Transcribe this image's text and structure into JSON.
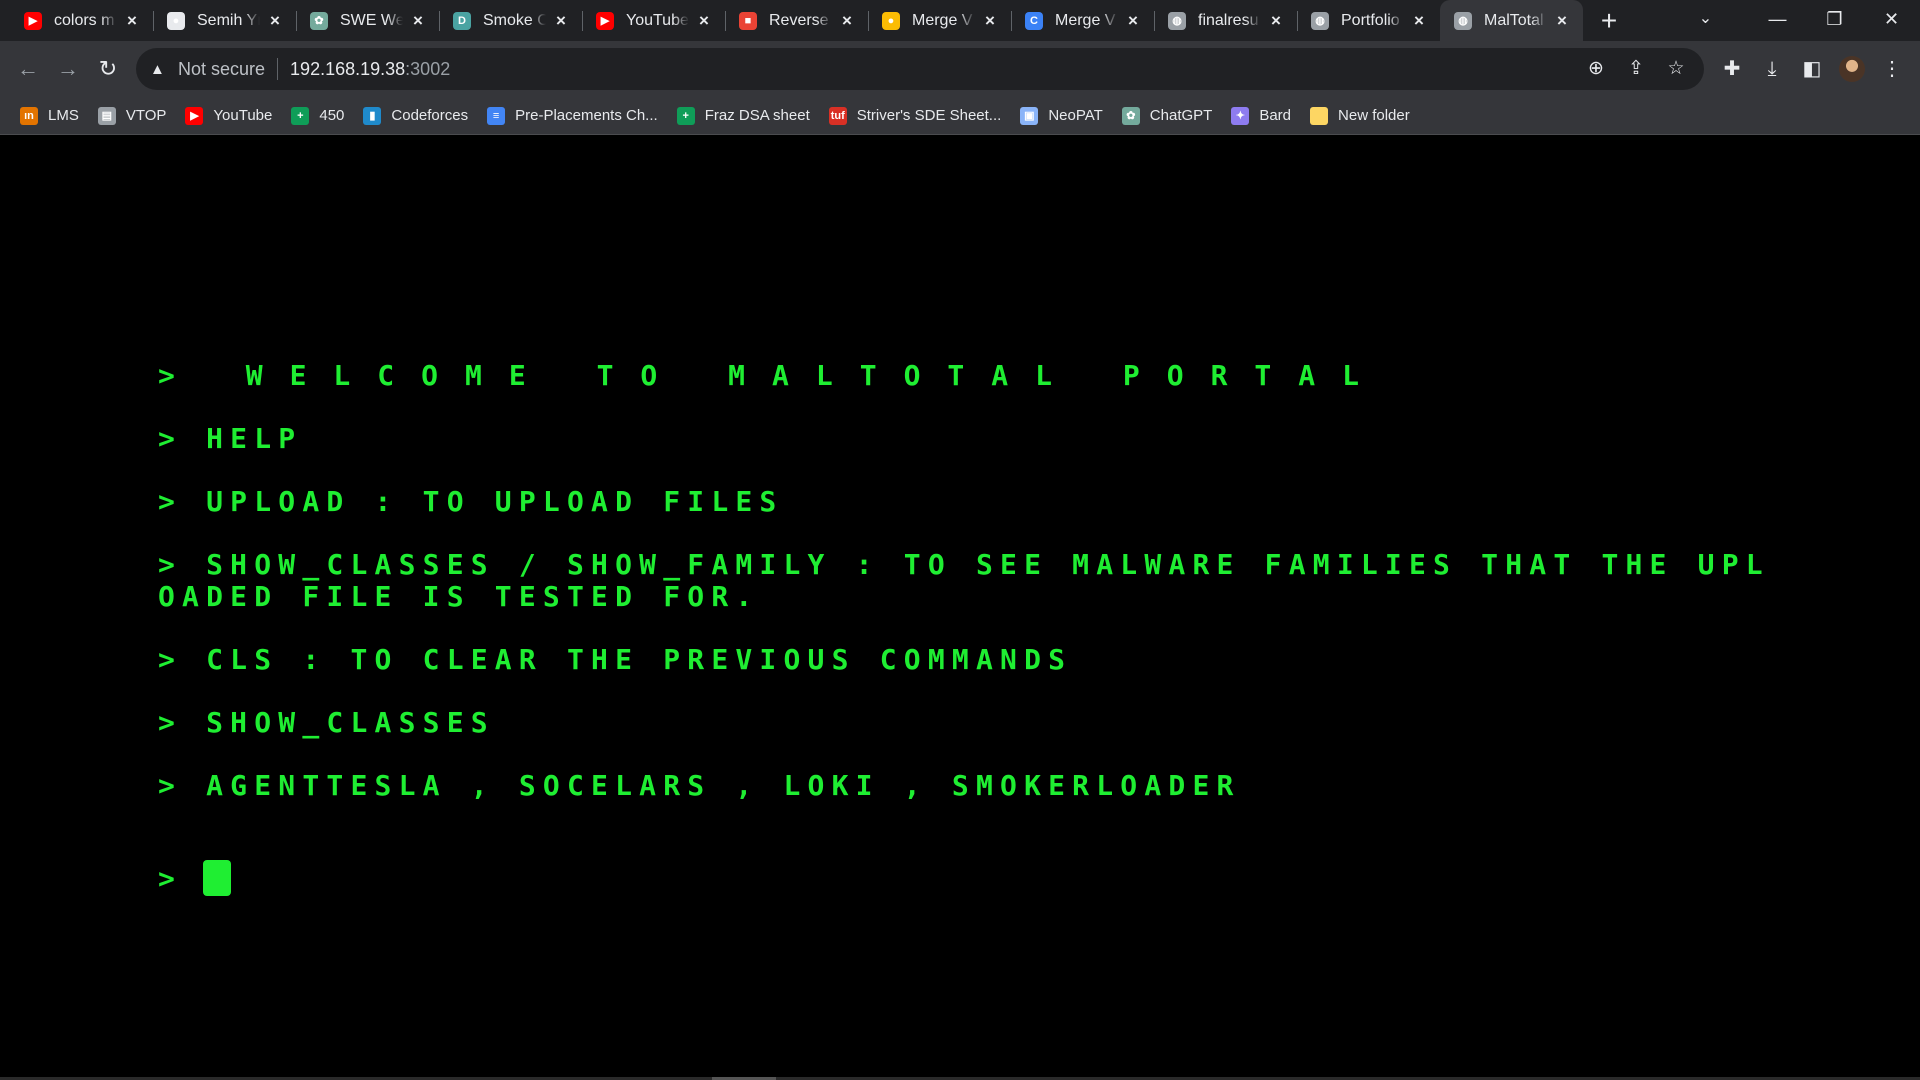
{
  "tabs": [
    {
      "title": "colors m",
      "favicon": "youtube-icon",
      "color": "#ff0000",
      "glyph": "▶"
    },
    {
      "title": "Semih Yı",
      "favicon": "github-icon",
      "color": "#e8eaed",
      "glyph": "●"
    },
    {
      "title": "SWE Wel",
      "favicon": "chatgpt-icon",
      "color": "#74aa9c",
      "glyph": "✿"
    },
    {
      "title": "Smoke C",
      "favicon": "document-icon",
      "color": "#4aa3a2",
      "glyph": "D"
    },
    {
      "title": "YouTube",
      "favicon": "youtube-icon",
      "color": "#ff0000",
      "glyph": "▶"
    },
    {
      "title": "Reverse",
      "favicon": "video-record-icon",
      "color": "#ea4335",
      "glyph": "■"
    },
    {
      "title": "Merge V",
      "favicon": "dots-icon",
      "color": "#fbbc04",
      "glyph": "●"
    },
    {
      "title": "Merge V",
      "favicon": "c-logo-icon",
      "color": "#3b82f6",
      "glyph": "C"
    },
    {
      "title": "finalresu",
      "favicon": "globe-icon",
      "color": "#9aa0a6",
      "glyph": "◍"
    },
    {
      "title": "Portfolio",
      "favicon": "globe-icon",
      "color": "#9aa0a6",
      "glyph": "◍"
    },
    {
      "title": "MalTotal",
      "favicon": "globe-icon",
      "color": "#9aa0a6",
      "glyph": "◍",
      "active": true
    }
  ],
  "window_controls": {
    "minimize": "—",
    "restore": "❐",
    "close": "✕",
    "tab_search": "⌄",
    "new_tab": "+"
  },
  "toolbar": {
    "security_label": "Not secure",
    "url_host": "192.168.19.38",
    "url_port": ":3002"
  },
  "bookmarks": [
    {
      "label": "LMS",
      "icon": "lms-icon",
      "color": "#e37400",
      "glyph": "ın"
    },
    {
      "label": "VTOP",
      "icon": "vtop-icon",
      "color": "#9aa0a6",
      "glyph": "▤"
    },
    {
      "label": "YouTube",
      "icon": "youtube-icon",
      "color": "#ff0000",
      "glyph": "▶"
    },
    {
      "label": "450",
      "icon": "sheets-icon",
      "color": "#0f9d58",
      "glyph": "+"
    },
    {
      "label": "Codeforces",
      "icon": "codeforces-icon",
      "color": "#1f8acb",
      "glyph": "▮"
    },
    {
      "label": "Pre-Placements Ch...",
      "icon": "docs-icon",
      "color": "#4285f4",
      "glyph": "≡"
    },
    {
      "label": "Fraz DSA sheet",
      "icon": "sheets-icon",
      "color": "#0f9d58",
      "glyph": "+"
    },
    {
      "label": "Striver's SDE Sheet...",
      "icon": "tuf-icon",
      "color": "#d93025",
      "glyph": "tuf"
    },
    {
      "label": "NeoPAT",
      "icon": "neopat-icon",
      "color": "#8ab4f8",
      "glyph": "▣"
    },
    {
      "label": "ChatGPT",
      "icon": "chatgpt-icon",
      "color": "#74aa9c",
      "glyph": "✿"
    },
    {
      "label": "Bard",
      "icon": "bard-icon",
      "color": "#8e7cf0",
      "glyph": "✦"
    },
    {
      "label": "New folder",
      "icon": "folder-icon",
      "color": "#fdd663",
      "glyph": ""
    }
  ],
  "terminal": {
    "text_color": "#1fee32",
    "welcome": "> WELCOME TO MALTOTAL PORTAL",
    "lines": [
      "> HELP",
      "> UPLOAD : TO UPLOAD FILES",
      "> SHOW_CLASSES / SHOW_FAMILY : TO SEE MALWARE FAMILIES THAT THE UPLOADED FILE IS TESTED FOR.",
      "> CLS : TO CLEAR THE PREVIOUS COMMANDS",
      "> SHOW_CLASSES",
      "> AGENTTESLA , SOCELARS , LOKI , SMOKERLOADER"
    ],
    "prompt": ">"
  }
}
